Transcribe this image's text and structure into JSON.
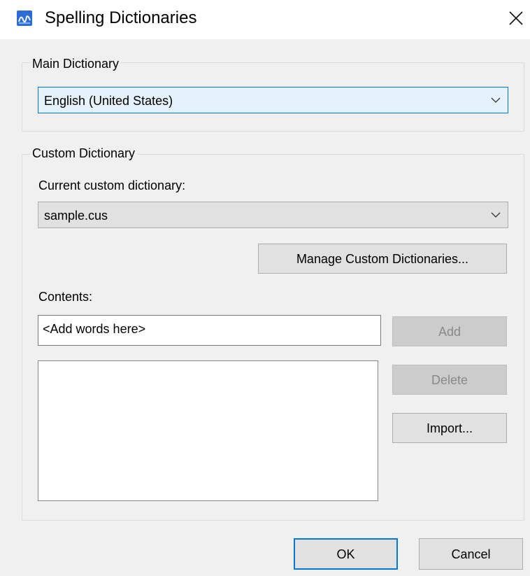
{
  "window": {
    "title": "Spelling Dictionaries"
  },
  "main_dictionary": {
    "group_label": "Main Dictionary",
    "selected": "English (United States)"
  },
  "custom_dictionary": {
    "group_label": "Custom Dictionary",
    "current_label": "Current custom dictionary:",
    "selected": "sample.cus",
    "manage_button": "Manage Custom Dictionaries...",
    "contents_label": "Contents:",
    "add_word_value": "<Add words here>",
    "add_button": "Add",
    "delete_button": "Delete",
    "import_button": "Import...",
    "words": []
  },
  "footer": {
    "ok_button": "OK",
    "cancel_button": "Cancel"
  },
  "colors": {
    "accent": "#0078d7",
    "dialog_bg": "#f0f0f0",
    "button_bg": "#e1e1e1",
    "disabled_text": "#8a8a8a"
  },
  "icons": {
    "app": "app-icon",
    "close": "close-icon",
    "dropdown": "chevron-down-icon"
  }
}
